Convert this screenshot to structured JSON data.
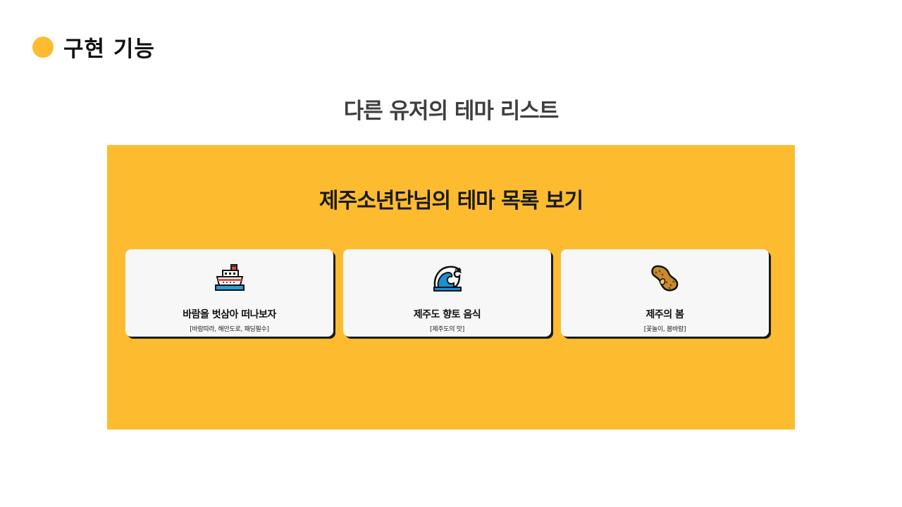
{
  "header": {
    "title": "구현 기능"
  },
  "subtitle": "다른 유저의 테마 리스트",
  "panel": {
    "title": "제주소년단님의 테마 목록 보기",
    "cards": [
      {
        "icon": "ship-icon",
        "title": "바람을 벗삼아 떠나보자",
        "tags": "[바람따라, 해안도로, 패딩필수]"
      },
      {
        "icon": "wave-icon",
        "title": "제주도 향토 음식",
        "tags": "[제주도의 맛]"
      },
      {
        "icon": "peanut-icon",
        "title": "제주의 봄",
        "tags": "[꽃놀이, 봄바람]"
      }
    ]
  },
  "colors": {
    "accent": "#fdbb2f",
    "panel_bg": "#fdbc30",
    "card_bg": "#f7f7f7"
  }
}
